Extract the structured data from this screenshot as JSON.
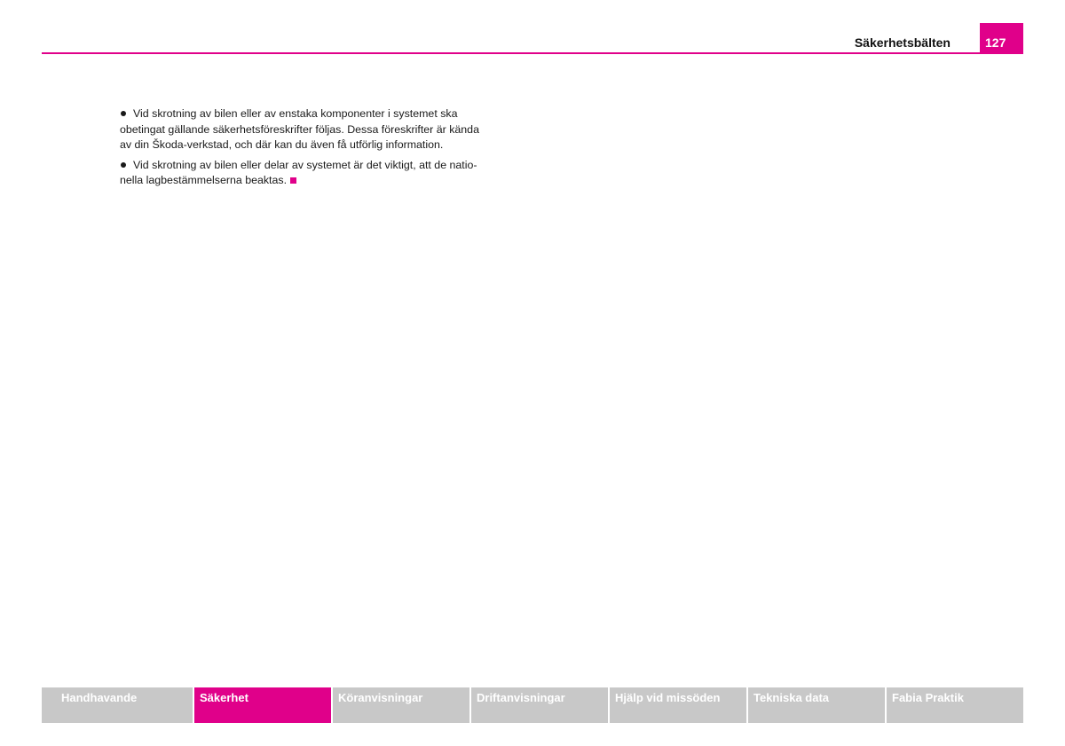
{
  "header": {
    "section_title": "Säkerhetsbälten",
    "page_number": "127"
  },
  "content": {
    "paragraphs": [
      {
        "lines": [
          "Vid skrotning av bilen eller av enstaka komponenter i systemet ska",
          "obetingat gällande säkerhetsföreskrifter följas. Dessa föreskrifter är kända",
          "av din Škoda-verkstad, och där kan du även få utförlig information."
        ]
      },
      {
        "lines": [
          "Vid skrotning av bilen eller delar av systemet är det viktigt, att de natio-",
          "nella lagbestämmelserna beaktas."
        ]
      }
    ]
  },
  "footer_nav": {
    "tabs": [
      {
        "label": "Handhavande",
        "active": false
      },
      {
        "label": "Säkerhet",
        "active": true
      },
      {
        "label": "Köranvisningar",
        "active": false
      },
      {
        "label": "Driftanvisningar",
        "active": false
      },
      {
        "label": "Hjälp vid missöden",
        "active": false
      },
      {
        "label": "Tekniska data",
        "active": false
      },
      {
        "label": "Fabia Praktik",
        "active": false
      }
    ]
  },
  "colors": {
    "accent": "#e0008a",
    "tab_inactive": "#c8c8c8",
    "text": "#1a1a1a"
  },
  "icons": {
    "bullet": "bullet-dot-icon",
    "section_end": "section-end-square-icon"
  }
}
